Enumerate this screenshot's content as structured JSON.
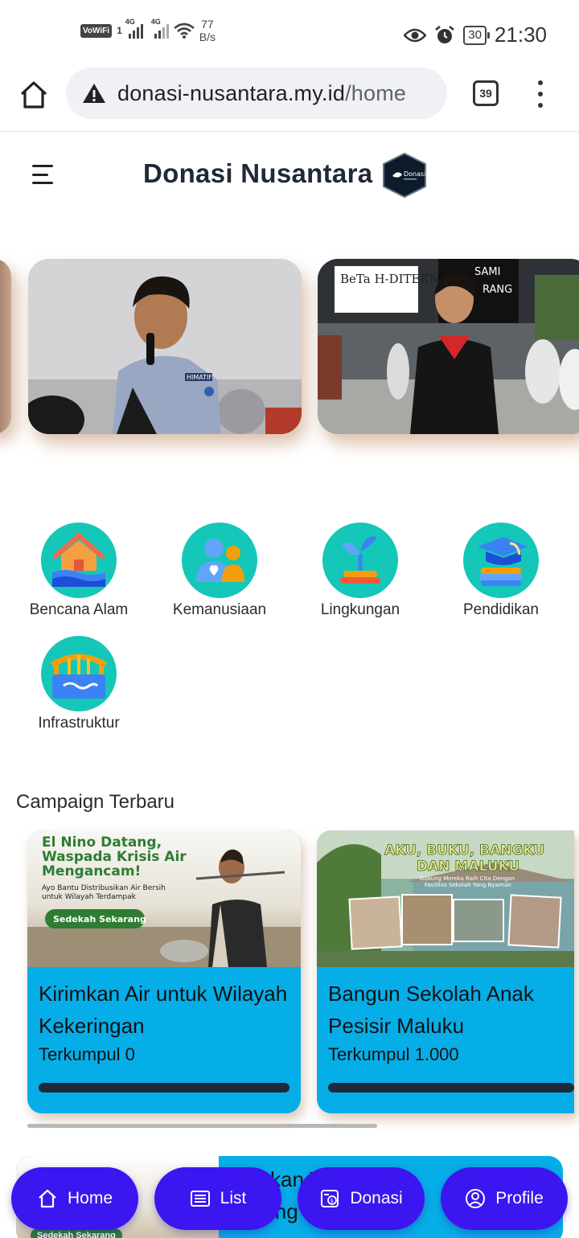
{
  "status_bar": {
    "vowifi": "VoWiFi",
    "sim": "1",
    "net1": "4G",
    "net2": "4G",
    "speed_value": "77",
    "speed_unit": "B/s",
    "battery": "30",
    "time": "21:30"
  },
  "browser": {
    "url_domain": "donasi-nusantara.my.id",
    "url_path": "/home",
    "tab_count": "39"
  },
  "header": {
    "title": "Donasi Nusantara",
    "logo_text": "Donasi"
  },
  "hero": {
    "slides": [
      {
        "badge": "HIMATIF"
      },
      {
        "sign": "BeTa H-DITEKNIK"
      }
    ]
  },
  "categories": [
    {
      "label": "Bencana Alam",
      "icon": "house-disaster-icon"
    },
    {
      "label": "Kemanusiaan",
      "icon": "people-heart-icon"
    },
    {
      "label": "Lingkungan",
      "icon": "plant-sprout-icon"
    },
    {
      "label": "Pendidikan",
      "icon": "graduation-cap-icon"
    },
    {
      "label": "Infrastruktur",
      "icon": "bridge-icon"
    }
  ],
  "campaigns": {
    "section_title": "Campaign Terbaru",
    "items": [
      {
        "banner_headline": "El Nino Datang, Waspada Krisis Air Mengancam!",
        "banner_sub": "Ayo Bantu Distribusikan Air Bersih untuk Wilayah Terdampak",
        "banner_button": "Sedekah Sekarang",
        "title": "Kirimkan Air untuk Wilayah Kekeringan",
        "collected": "Terkumpul 0",
        "progress": 0
      },
      {
        "banner_headline": "AKU, BUKU, BANGKU DAN MALUKU",
        "banner_sub": "Dukung Mereka Raih Cita Dengan Fasilitas Sekolah Yang Nyaman",
        "title": "Bangun Sekolah Anak Pesisir Maluku",
        "collected": "Terkumpul 1.000",
        "progress": 0
      }
    ],
    "next_item": {
      "title_fragment_1": "kan        Wila",
      "title_fragment_2": "ing",
      "tag": "Sedekah Sekarang"
    }
  },
  "bottom_nav": [
    {
      "label": "Home",
      "icon": "home-icon"
    },
    {
      "label": "List",
      "icon": "list-icon"
    },
    {
      "label": "Donasi",
      "icon": "donate-icon"
    },
    {
      "label": "Profile",
      "icon": "profile-icon"
    }
  ],
  "colors": {
    "accent_nav": "#3b16f0",
    "card_blue": "#06aee8",
    "category_teal": "#14c7b8"
  }
}
